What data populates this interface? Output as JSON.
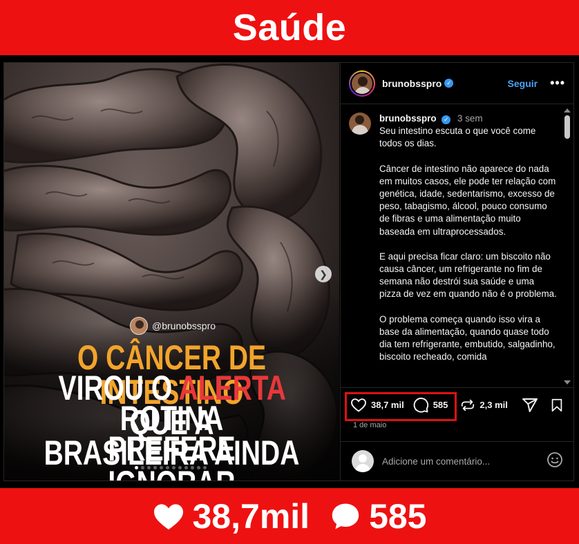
{
  "banner": {
    "title": "Saúde"
  },
  "post": {
    "media": {
      "watermark": "@brunobsspro",
      "headline": {
        "line1": "O CÂNCER DE INTESTINO",
        "line2_pre": "VIROU O ",
        "line2_red": "ALERTA",
        "line2_post": " QUE A",
        "line3": "ROTINA BRASILEIRA AINDA",
        "line4": "PREFERE IGNORAR"
      },
      "carousel": {
        "slide_count": 12,
        "current_slide": 1
      }
    },
    "header": {
      "username": "brunobsspro",
      "verified": true,
      "follow_label": "Seguir",
      "more_label": "•••"
    },
    "caption": {
      "username": "brunobsspro",
      "time": "3 sem",
      "paragraphs": [
        "Seu intestino escuta o que você come todos os dias.",
        "Câncer de intestino não aparece do nada em muitos casos, ele pode ter relação com genética, idade, sedentarismo, excesso de peso, tabagismo, álcool, pouco consumo de fibras e uma alimentação muito baseada em ultraprocessados.",
        "E aqui precisa ficar claro: um biscoito não causa câncer, um refrigerante no fim de semana não destrói sua saúde e uma pizza de vez em quando não é o problema.",
        "O problema começa quando isso vira a base da alimentação, quando quase todo dia tem refrigerante, embutido, salgadinho, biscoito recheado, comida"
      ]
    },
    "actions": {
      "likes": "38,7 mil",
      "comments": "585",
      "reposts": "2,3 mil"
    },
    "date": "1 de maio",
    "comment_placeholder": "Adicione um comentário..."
  },
  "bottom_banner": {
    "likes": "38,7mil",
    "comments": "585"
  },
  "icons": {
    "like": "heart-icon",
    "comment": "comment-bubble-icon",
    "repost": "repost-icon",
    "share": "send-icon",
    "save": "bookmark-icon",
    "emoji": "emoji-icon",
    "next": "chevron-right-icon"
  },
  "colors": {
    "banner": "#ee1111",
    "follow": "#4aa3f5",
    "headline_orange": "#f2a42b",
    "headline_red": "#e8383a"
  }
}
